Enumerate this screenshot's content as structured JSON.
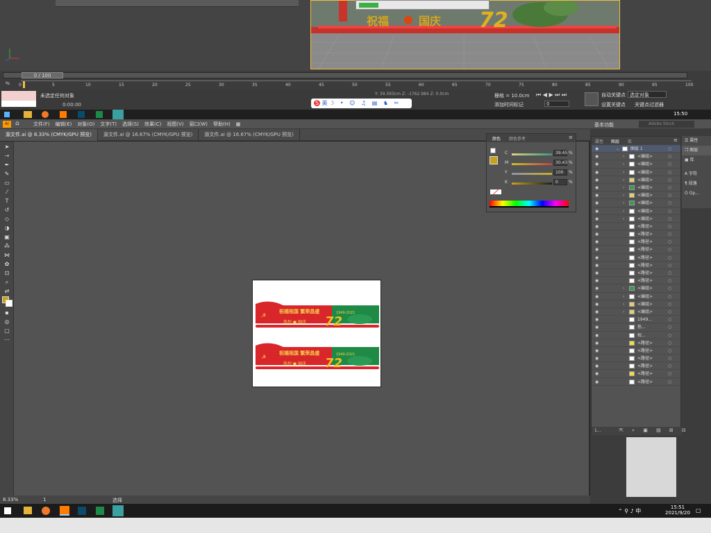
{
  "max": {
    "frame_counter": "0 / 100",
    "status_label": "未选定任何对象",
    "time_display": "0:00:00",
    "coord_x": "Y: 39.593cm",
    "coord_y": "Z: -1762.984",
    "coord_z": "Z: 0.0cm",
    "grid": "栅格 = 10.0cm",
    "auto_key": "自动关键点",
    "selected": "选定对象",
    "set_key": "设置关键点",
    "key_filter": "关键点过滤器",
    "add_time_tag": "添加时间标记",
    "frame_field": "0",
    "ruler_ticks": [
      "0",
      "5",
      "10",
      "15",
      "20",
      "25",
      "30",
      "35",
      "40",
      "45",
      "50",
      "55",
      "60",
      "65",
      "70",
      "75",
      "80",
      "85",
      "90",
      "95",
      "100"
    ],
    "ime_label": "英"
  },
  "ai": {
    "menu": [
      "文件(F)",
      "编辑(E)",
      "对象(O)",
      "文字(T)",
      "选择(S)",
      "效果(C)",
      "视图(V)",
      "窗口(W)",
      "帮助(H)"
    ],
    "workspace": "基本功能",
    "search_placeholder": "Adobe Stock",
    "tabs": [
      "源文件.ai @ 8.33% (CMYK/GPU 预览)",
      "源文件.ai @ 16.67% (CMYK/GPU 预览)",
      "源文件.ai @ 16.67% (CMYK/GPU 预览)"
    ],
    "zoom": "8.33%",
    "artboard_num": "1",
    "status_tool": "选择",
    "color_panel": {
      "tab1": "颜色",
      "tab2": "颜色参考",
      "c_label": "C",
      "m_label": "M",
      "y_label": "Y",
      "k_label": "K",
      "c": "39.45",
      "m": "30.43",
      "y": "100",
      "k": "0",
      "pct": "%"
    },
    "layers_panel": {
      "tab_props": "属性",
      "tab_layers": "图层",
      "tab_lib": "库",
      "top_layer": "图层 1",
      "rows": [
        "<编组>",
        "<编组>",
        "<编组>",
        "<编组>",
        "<编组>",
        "<编组>",
        "<编组>",
        "<编组>",
        "<编组>",
        "<路径>",
        "<路径>",
        "<路径>",
        "<路径>",
        "<路径>",
        "<路径>",
        "<路径>",
        "<路径>",
        "<编组>",
        "<编组>",
        "<编组>",
        "<编组>",
        "1949...",
        "热...",
        "祝...",
        "<路径>",
        "<路径>",
        "<路径>",
        "<路径>",
        "<路径>",
        "<路径>"
      ],
      "footer": "1..."
    },
    "right_dock": [
      "属性",
      "图层",
      "库",
      "字符",
      "段落",
      "Op..."
    ]
  },
  "artwork": {
    "slogan": "祝福祖国  繁荣昌盛",
    "number": "72",
    "years": "1949-2021"
  },
  "taskbar": {
    "time": "15:51",
    "date": "2021/9/20",
    "lang": "中",
    "top_time": "15:50"
  }
}
